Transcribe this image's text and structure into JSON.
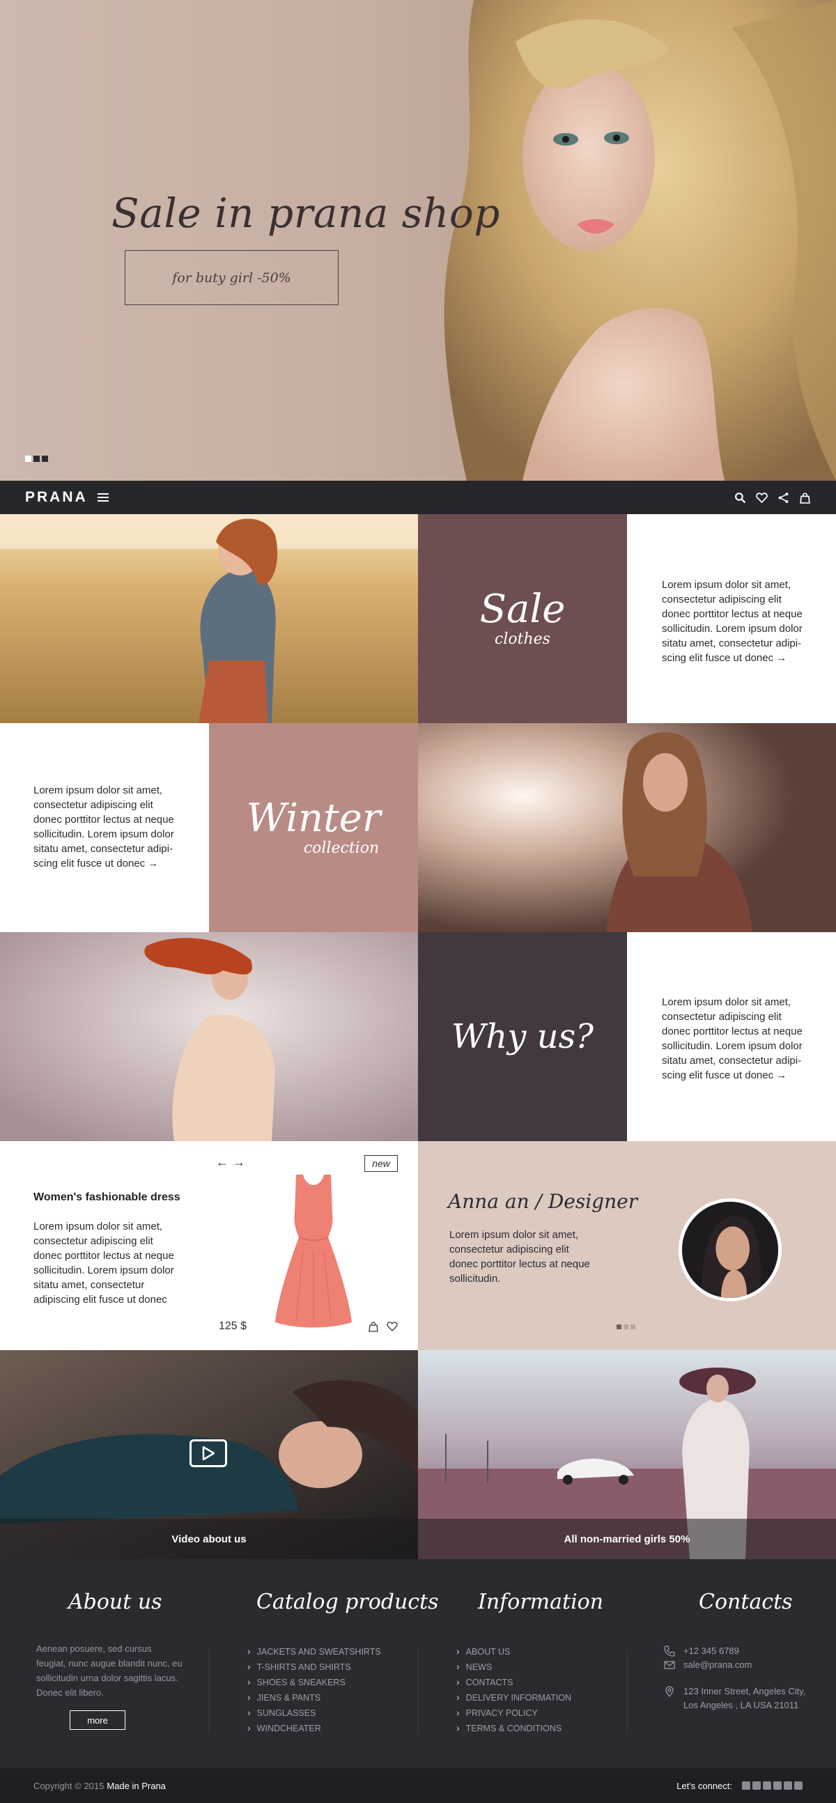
{
  "hero": {
    "title": "Sale in prana shop",
    "button_label": "for buty girl -50%",
    "slide_count": 3,
    "active_slide": 1
  },
  "nav": {
    "logo": "PRANA",
    "icons": [
      "search-icon",
      "heart-icon",
      "share-icon",
      "bag-icon"
    ]
  },
  "tiles": {
    "sale": {
      "title": "Sale",
      "subtitle": "clothes",
      "color": "#6e4f4f"
    },
    "sale_text": "Lorem ipsum dolor sit amet, consectetur adipiscing elit donec porttitor lectus at neque sollicitudin. Lorem ipsum dolor sitatu amet, consectetur adipi-scing elit fusce ut donec",
    "winter": {
      "title": "Winter",
      "subtitle": "collection",
      "color": "#b88c85"
    },
    "winter_text": "Lorem ipsum dolor sit amet, consectetur adipiscing elit donec porttitor lectus at neque sollicitudin. Lorem ipsum dolor sitatu amet, consectetur adipi-scing elit fusce ut donec",
    "why": {
      "title": "Why us?",
      "color": "#433840"
    },
    "why_text": "Lorem ipsum dolor sit amet, consectetur adipiscing elit donec porttitor lectus at neque sollicitudin. Lorem ipsum dolor sitatu amet, consectetur adipi-scing elit fusce ut donec",
    "arrow": "→"
  },
  "product": {
    "title": "Women's fashionable dress",
    "description": "Lorem ipsum dolor sit amet, consectetur adipiscing elit donec porttitor lectus at neque sollicitudin. Lorem ipsum dolor sitatu amet, consectetur adipiscing elit fusce ut donec",
    "price": "125 $",
    "badge": "new",
    "prev_arrow": "←",
    "next_arrow": "→"
  },
  "designer": {
    "name": "Anna an / Designer",
    "description": "Lorem ipsum dolor sit amet, consectetur adipiscing elit donec porttitor lectus at neque sollicitudin.",
    "slide_count": 3,
    "active_slide": 1
  },
  "media": {
    "video_caption": "Video about us",
    "promo_caption": "All non-married girls 50%"
  },
  "footer": {
    "about": {
      "heading": "About us",
      "text": "Aenean posuere, sed cursus feugiat, nunc augue blandit nunc, eu sollicitudin urna dolor sagittis lacus. Donec elit libero.",
      "more_label": "more"
    },
    "catalog": {
      "heading": "Catalog products",
      "items": [
        "JACKETS AND SWEATSHIRTS",
        "T-SHIRTS AND SHIRTS",
        "SHOES & SNEAKERS",
        "JIENS & PANTS",
        "SUNGLASSES",
        "WINDCHEATER"
      ]
    },
    "information": {
      "heading": "Information",
      "items": [
        "ABOUT US",
        "NEWS",
        "CONTACTS",
        "DELIVERY INFORMATION",
        "PRIVACY POLICY",
        "TERMS & CONDITIONS"
      ]
    },
    "contacts": {
      "heading": "Contacts",
      "phone": "+12 345 6789",
      "email": "sale@prana.com",
      "address_line1": "123 Inner Street, Angeles City,",
      "address_line2": "Los Angeles , LA USA 21011"
    }
  },
  "bottom_bar": {
    "copyright": "Copyright © 2015",
    "made_in": "Made in Prana",
    "connect_label": "Let's connect:",
    "social_icons": [
      "tumblr-icon",
      "twitter-icon",
      "vimeo-icon",
      "google-plus-icon",
      "linkedin-icon",
      "camera-icon"
    ]
  }
}
